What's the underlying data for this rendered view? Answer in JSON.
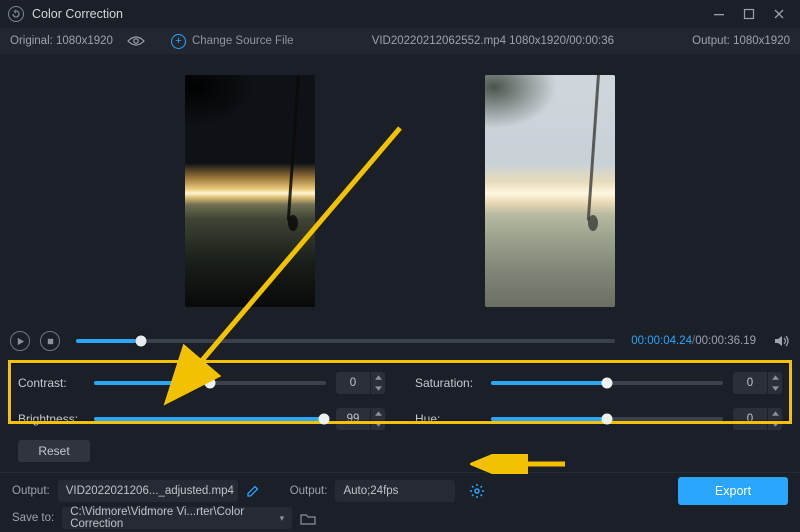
{
  "window": {
    "title": "Color Correction"
  },
  "source": {
    "original_label": "Original: 1080x1920",
    "change_label": "Change Source File",
    "file_info": "VID20220212062552.mp4    1080x1920/00:00:36",
    "output_label": "Output: 1080x1920"
  },
  "timeline": {
    "progress_pct": 12,
    "current": "00:00:04.24",
    "total": "00:00:36.19"
  },
  "controls": {
    "contrast": {
      "label": "Contrast:",
      "value": "0",
      "pct": 50
    },
    "saturation": {
      "label": "Saturation:",
      "value": "0",
      "pct": 50
    },
    "brightness": {
      "label": "Brightness:",
      "value": "99",
      "pct": 99
    },
    "hue": {
      "label": "Hue:",
      "value": "0",
      "pct": 50
    },
    "reset": "Reset"
  },
  "output": {
    "label1": "Output:",
    "filename": "VID2022021206..._adjusted.mp4",
    "label2": "Output:",
    "format": "Auto;24fps",
    "export": "Export",
    "saveto_label": "Save to:",
    "path": "C:\\Vidmore\\Vidmore Vi...rter\\Color Correction"
  }
}
